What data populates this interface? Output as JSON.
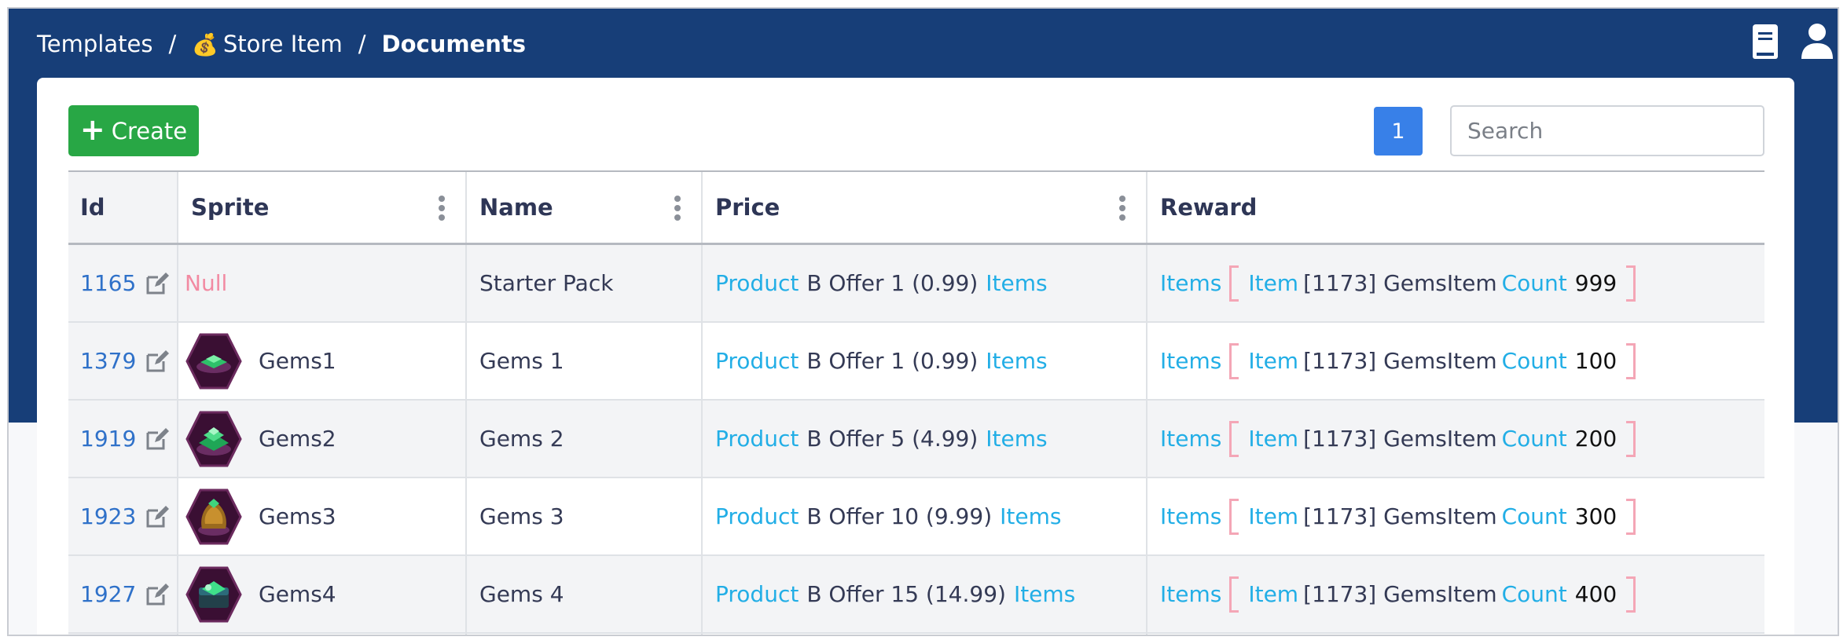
{
  "breadcrumb": {
    "templates": "Templates",
    "separator": "/",
    "store_item_icon": "💰",
    "store_item": "Store Item",
    "documents": "Documents"
  },
  "toolbar": {
    "create_label": "Create",
    "page_number": "1",
    "search_placeholder": "Search"
  },
  "icons": {
    "top_left": "book-icon",
    "top_right": "user-icon"
  },
  "colors": {
    "nav": "#173e78",
    "create": "#28a745",
    "page_active": "#3880e8",
    "link": "#22aee6",
    "id_link": "#2f71c9",
    "null": "#f28aa2",
    "bracket": "#f4a6b6"
  },
  "table": {
    "columns": {
      "id": "Id",
      "sprite": "Sprite",
      "name": "Name",
      "price": "Price",
      "reward": "Reward"
    },
    "rows": [
      {
        "id": "1165",
        "sprite": "Null",
        "name": "Starter Pack",
        "price_link": "Product",
        "price_text": "B Offer 1 (0.99)",
        "price_items": "Items",
        "reward_items": "Items",
        "reward_item": "Item",
        "reward_item_text": "[1173] GemsItem",
        "reward_count_label": "Count",
        "reward_count": "999"
      },
      {
        "id": "1379",
        "sprite": "Gems1",
        "name": "Gems 1",
        "price_link": "Product",
        "price_text": "B Offer 1 (0.99)",
        "price_items": "Items",
        "reward_items": "Items",
        "reward_item": "Item",
        "reward_item_text": "[1173] GemsItem",
        "reward_count_label": "Count",
        "reward_count": "100"
      },
      {
        "id": "1919",
        "sprite": "Gems2",
        "name": "Gems 2",
        "price_link": "Product",
        "price_text": "B Offer 5 (4.99)",
        "price_items": "Items",
        "reward_items": "Items",
        "reward_item": "Item",
        "reward_item_text": "[1173] GemsItem",
        "reward_count_label": "Count",
        "reward_count": "200"
      },
      {
        "id": "1923",
        "sprite": "Gems3",
        "name": "Gems 3",
        "price_link": "Product",
        "price_text": "B Offer 10 (9.99)",
        "price_items": "Items",
        "reward_items": "Items",
        "reward_item": "Item",
        "reward_item_text": "[1173] GemsItem",
        "reward_count_label": "Count",
        "reward_count": "300"
      },
      {
        "id": "1927",
        "sprite": "Gems4",
        "name": "Gems 4",
        "price_link": "Product",
        "price_text": "B Offer 15 (14.99)",
        "price_items": "Items",
        "reward_items": "Items",
        "reward_item": "Item",
        "reward_item_text": "[1173] GemsItem",
        "reward_count_label": "Count",
        "reward_count": "400"
      }
    ]
  }
}
